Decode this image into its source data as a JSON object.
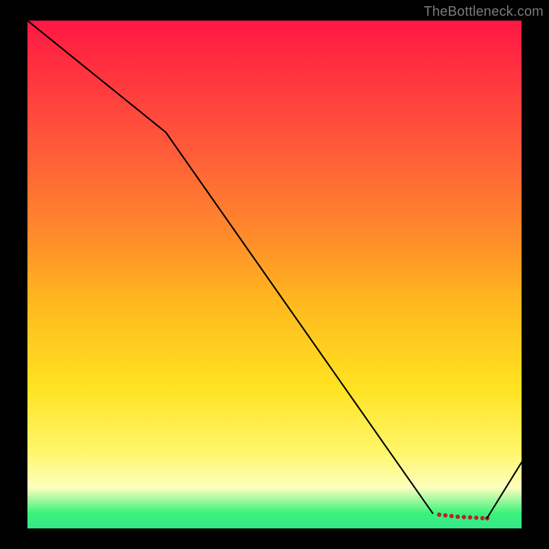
{
  "watermark": "TheBottleneck.com",
  "chart_data": {
    "type": "line",
    "title": "",
    "xlabel": "",
    "ylabel": "",
    "xlim": [
      0,
      100
    ],
    "ylim": [
      0,
      100
    ],
    "x": [
      0,
      28,
      82,
      93,
      100
    ],
    "values": [
      100,
      78,
      3,
      2,
      13
    ],
    "dotted_segment": {
      "x": [
        82,
        93
      ],
      "values": [
        3,
        2
      ]
    },
    "background_gradient": {
      "top": "#ff1744",
      "mid_upper": "#ff8a2b",
      "mid": "#ffe220",
      "mid_lower": "#fdffbe",
      "bottom": "#34e889"
    }
  }
}
